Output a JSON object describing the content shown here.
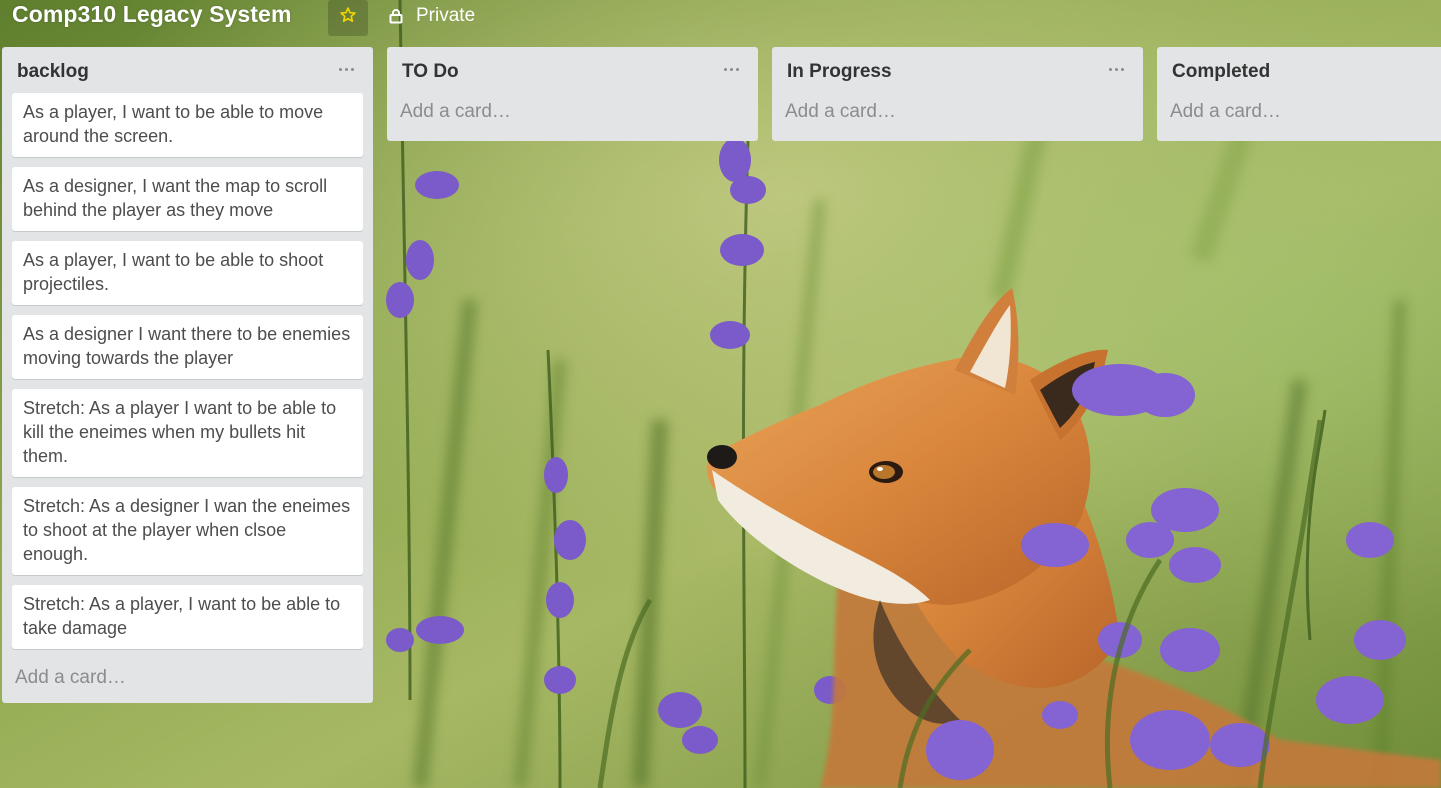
{
  "board": {
    "title": "Comp310 Legacy System",
    "privacy_label": "Private",
    "colors": {
      "list_bg": "#e2e4e6",
      "card_bg": "#ffffff",
      "star": "#f2d600",
      "muted_text": "#8c8c8c"
    },
    "icons": {
      "star": "star-icon",
      "privacy": "lock-icon",
      "list_menu": "ellipsis-icon"
    }
  },
  "lists": [
    {
      "title": "backlog",
      "add_card_label": "Add a card…",
      "cards": [
        "As a player, I want to be able to move around the screen.",
        "As a designer, I want the map to scroll behind the player as they move",
        "As a player, I want to be able to shoot projectiles.",
        "As a designer I want there to be enemies moving towards the player",
        "Stretch: As a player I want to be able to kill the eneimes when my bullets hit them.",
        "Stretch: As a designer I wan the eneimes to shoot at the player when clsoe enough.",
        "Stretch: As a player, I want to be able to take damage"
      ]
    },
    {
      "title": "TO Do",
      "add_card_label": "Add a card…",
      "cards": []
    },
    {
      "title": "In Progress",
      "add_card_label": "Add a card…",
      "cards": []
    },
    {
      "title": "Completed",
      "add_card_label": "Add a card…",
      "cards": []
    }
  ]
}
